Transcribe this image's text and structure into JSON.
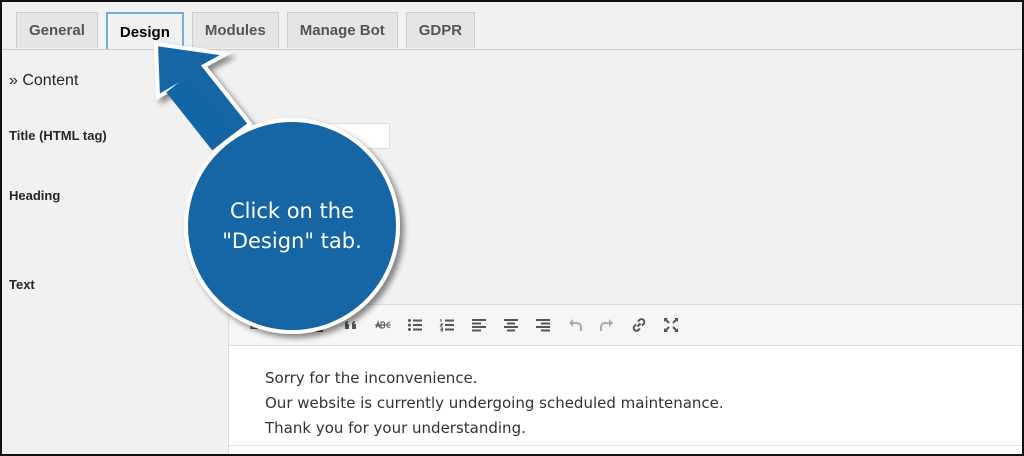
{
  "tabs": [
    {
      "label": "General",
      "active": false
    },
    {
      "label": "Design",
      "active": true
    },
    {
      "label": "Modules",
      "active": false
    },
    {
      "label": "Manage Bot",
      "active": false
    },
    {
      "label": "GDPR",
      "active": false
    }
  ],
  "section": {
    "title": "» Content"
  },
  "fields": {
    "title_label": "Title (HTML tag)",
    "heading_label": "Heading",
    "text_label": "Text"
  },
  "editor": {
    "toolbar": {
      "bold": "B"
    },
    "lines": [
      "Sorry for the inconvenience.",
      "Our website is currently undergoing scheduled maintenance.",
      "Thank you for your understanding."
    ]
  },
  "callout": {
    "line1": "Click on the",
    "line2": "\"Design\" tab.",
    "color": "#1366a6"
  }
}
